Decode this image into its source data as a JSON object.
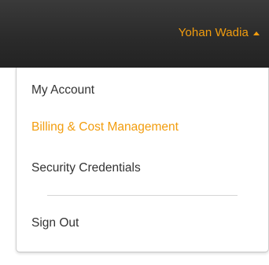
{
  "header": {
    "user_name": "Yohan Wadia"
  },
  "menu": {
    "items": [
      {
        "label": "My Account"
      },
      {
        "label": "Billing & Cost Management",
        "active": true
      },
      {
        "label": "Security Credentials"
      },
      {
        "label": "Sign Out"
      }
    ]
  },
  "colors": {
    "accent": "#f29d0e",
    "topbar": "#2b2b2b",
    "text": "#333333"
  }
}
